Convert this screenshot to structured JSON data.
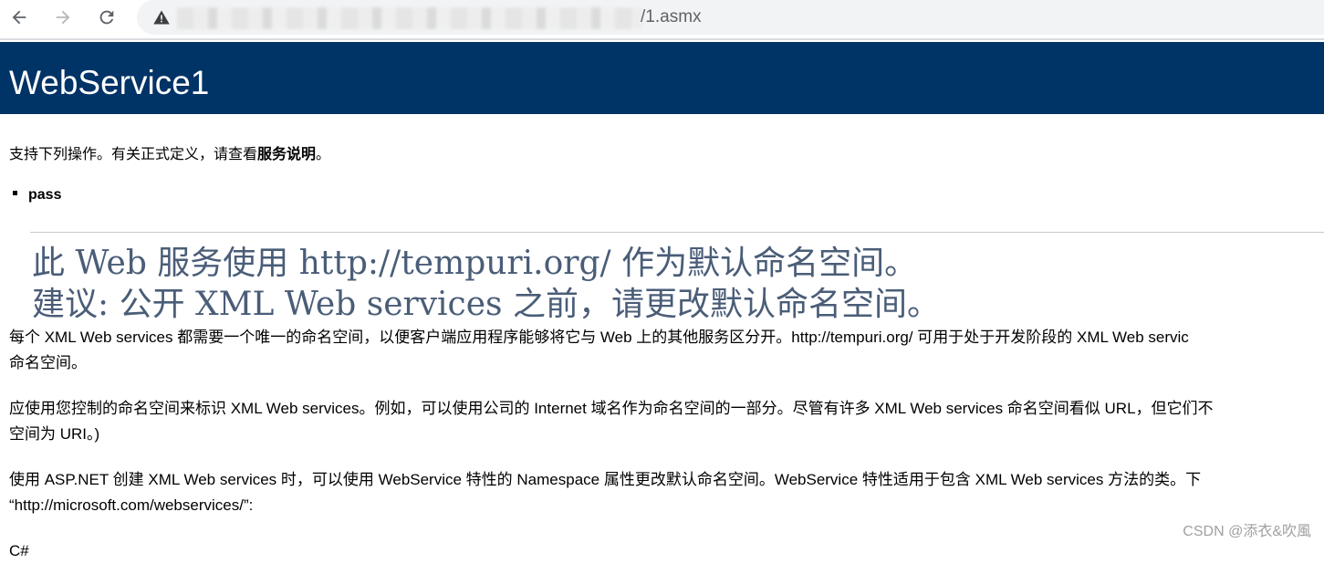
{
  "browser": {
    "url_suffix": "/1.asmx",
    "back_icon": "arrow-left-icon",
    "forward_icon": "arrow-right-icon",
    "reload_icon": "reload-icon",
    "security_icon": "warning-triangle-icon"
  },
  "header": {
    "title": "WebService1"
  },
  "intro": {
    "text": "支持下列操作。有关正式定义，请查看",
    "link": "服务说明",
    "end": "。"
  },
  "operations": [
    "pass"
  ],
  "warning": {
    "line1": "此 Web 服务使用 http://tempuri.org/ 作为默认命名空间。",
    "line2": "建议: 公开 XML Web services 之前，请更改默认命名空间。"
  },
  "paragraphs": [
    "每个 XML Web services 都需要一个唯一的命名空间，以便客户端应用程序能够将它与 Web 上的其他服务区分开。http://tempuri.org/ 可用于处于开发阶段的 XML Web servic",
    "命名空间。",
    "应使用您控制的命名空间来标识 XML Web services。例如，可以使用公司的 Internet 域名作为命名空间的一部分。尽管有许多 XML Web services 命名空间看似 URL，但它们不",
    "空间为 URI。)",
    "使用 ASP.NET 创建 XML Web services 时，可以使用 WebService 特性的 Namespace 属性更改默认命名空间。WebService 特性适用于包含 XML Web services 方法的类。下",
    "“http://microsoft.com/webservices/”:",
    "C#"
  ],
  "watermark": "CSDN @添衣&吹風",
  "colors": {
    "header_bg": "#003366",
    "header_text": "#ffffff",
    "warning_text": "#4a5d78"
  }
}
